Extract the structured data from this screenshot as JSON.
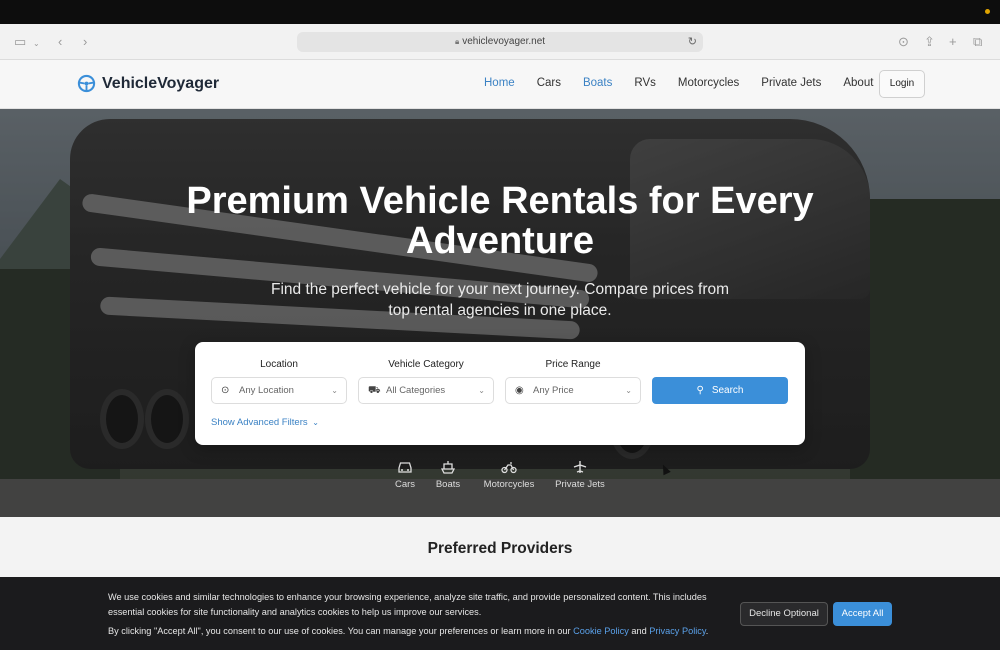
{
  "browser": {
    "url": "vehiclevoyager.net"
  },
  "nav": {
    "logo_text": "VehicleVoyager",
    "links": [
      {
        "label": "Home",
        "active": true
      },
      {
        "label": "Cars",
        "active": false
      },
      {
        "label": "Boats",
        "active": true
      },
      {
        "label": "RVs",
        "active": false
      },
      {
        "label": "Motorcycles",
        "active": false
      },
      {
        "label": "Private Jets",
        "active": false
      },
      {
        "label": "About",
        "active": false
      }
    ],
    "login_label": "Login"
  },
  "hero": {
    "title": "Premium Vehicle Rentals for Every Adventure",
    "subtitle": "Find the perfect vehicle for your next journey. Compare prices from top rental agencies in one place."
  },
  "search": {
    "location_label": "Location",
    "location_value": "Any Location",
    "category_label": "Vehicle Category",
    "category_value": "All Categories",
    "price_label": "Price Range",
    "price_value": "Any Price",
    "search_label": "Search",
    "advanced_filters": "Show Advanced Filters"
  },
  "categories": [
    {
      "label": "Cars",
      "icon": "car-icon"
    },
    {
      "label": "Boats",
      "icon": "boat-icon"
    },
    {
      "label": "Motorcycles",
      "icon": "motorcycle-icon"
    },
    {
      "label": "Private Jets",
      "icon": "plane-icon"
    }
  ],
  "providers": {
    "title": "Preferred Providers"
  },
  "cookie": {
    "text1": "We use cookies and similar technologies to enhance your browsing experience, analyze site traffic, and provide personalized content. This includes essential cookies for site functionality and analytics cookies to help us improve our services.",
    "text2_prefix": "By clicking \"Accept All\", you consent to our use of cookies. You can manage your preferences or learn more in our",
    "cookie_policy": "Cookie Policy",
    "and": "and",
    "privacy_policy": "Privacy Policy",
    "period": ".",
    "decline_label": "Decline Optional",
    "accept_label": "Accept All"
  },
  "colors": {
    "accent": "#3b8fd9",
    "link": "#3b82c4"
  }
}
